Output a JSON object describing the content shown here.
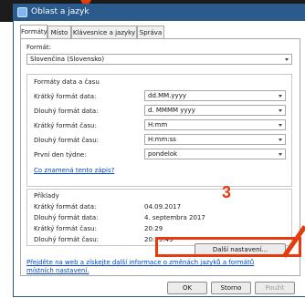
{
  "window": {
    "title": "Oblast a jazyk"
  },
  "tabs": [
    "Formáty",
    "Místo",
    "Klávesnice a jazyky",
    "Správa"
  ],
  "format": {
    "label": "Formát:",
    "value": "Slovenčina (Slovensko)"
  },
  "datetime_group": {
    "title": "Formáty data a času",
    "rows": [
      {
        "label": "Krátký formát data:",
        "value": "dd.MM.yyyy"
      },
      {
        "label": "Dlouhý formát data:",
        "value": "d. MMMM yyyy"
      },
      {
        "label": "Krátký formát času:",
        "value": "H:mm"
      },
      {
        "label": "Dlouhý formát času:",
        "value": "H:mm:ss"
      },
      {
        "label": "První den týdne:",
        "value": "pondelok"
      }
    ],
    "link": "Co znamená tento zápis?"
  },
  "examples": {
    "title": "Příklady",
    "rows": [
      {
        "label": "Krátký formát data:",
        "value": "04.09.2017"
      },
      {
        "label": "Dlouhý formát data:",
        "value": "4. septembra 2017"
      },
      {
        "label": "Krátký formát času:",
        "value": "20:29"
      },
      {
        "label": "Dlouhý formát času:",
        "value": "20:29:49"
      }
    ]
  },
  "more_settings_button": "Další nastavení...",
  "web_link": {
    "line1": "Přejděte na web a získejte další informace o změnách jazyků a formátů",
    "line2": "místních nastavení."
  },
  "footer": {
    "ok": "OK",
    "cancel": "Storno",
    "apply": "Použít"
  },
  "annotation": {
    "number": "3",
    "color": "#e53b10"
  }
}
